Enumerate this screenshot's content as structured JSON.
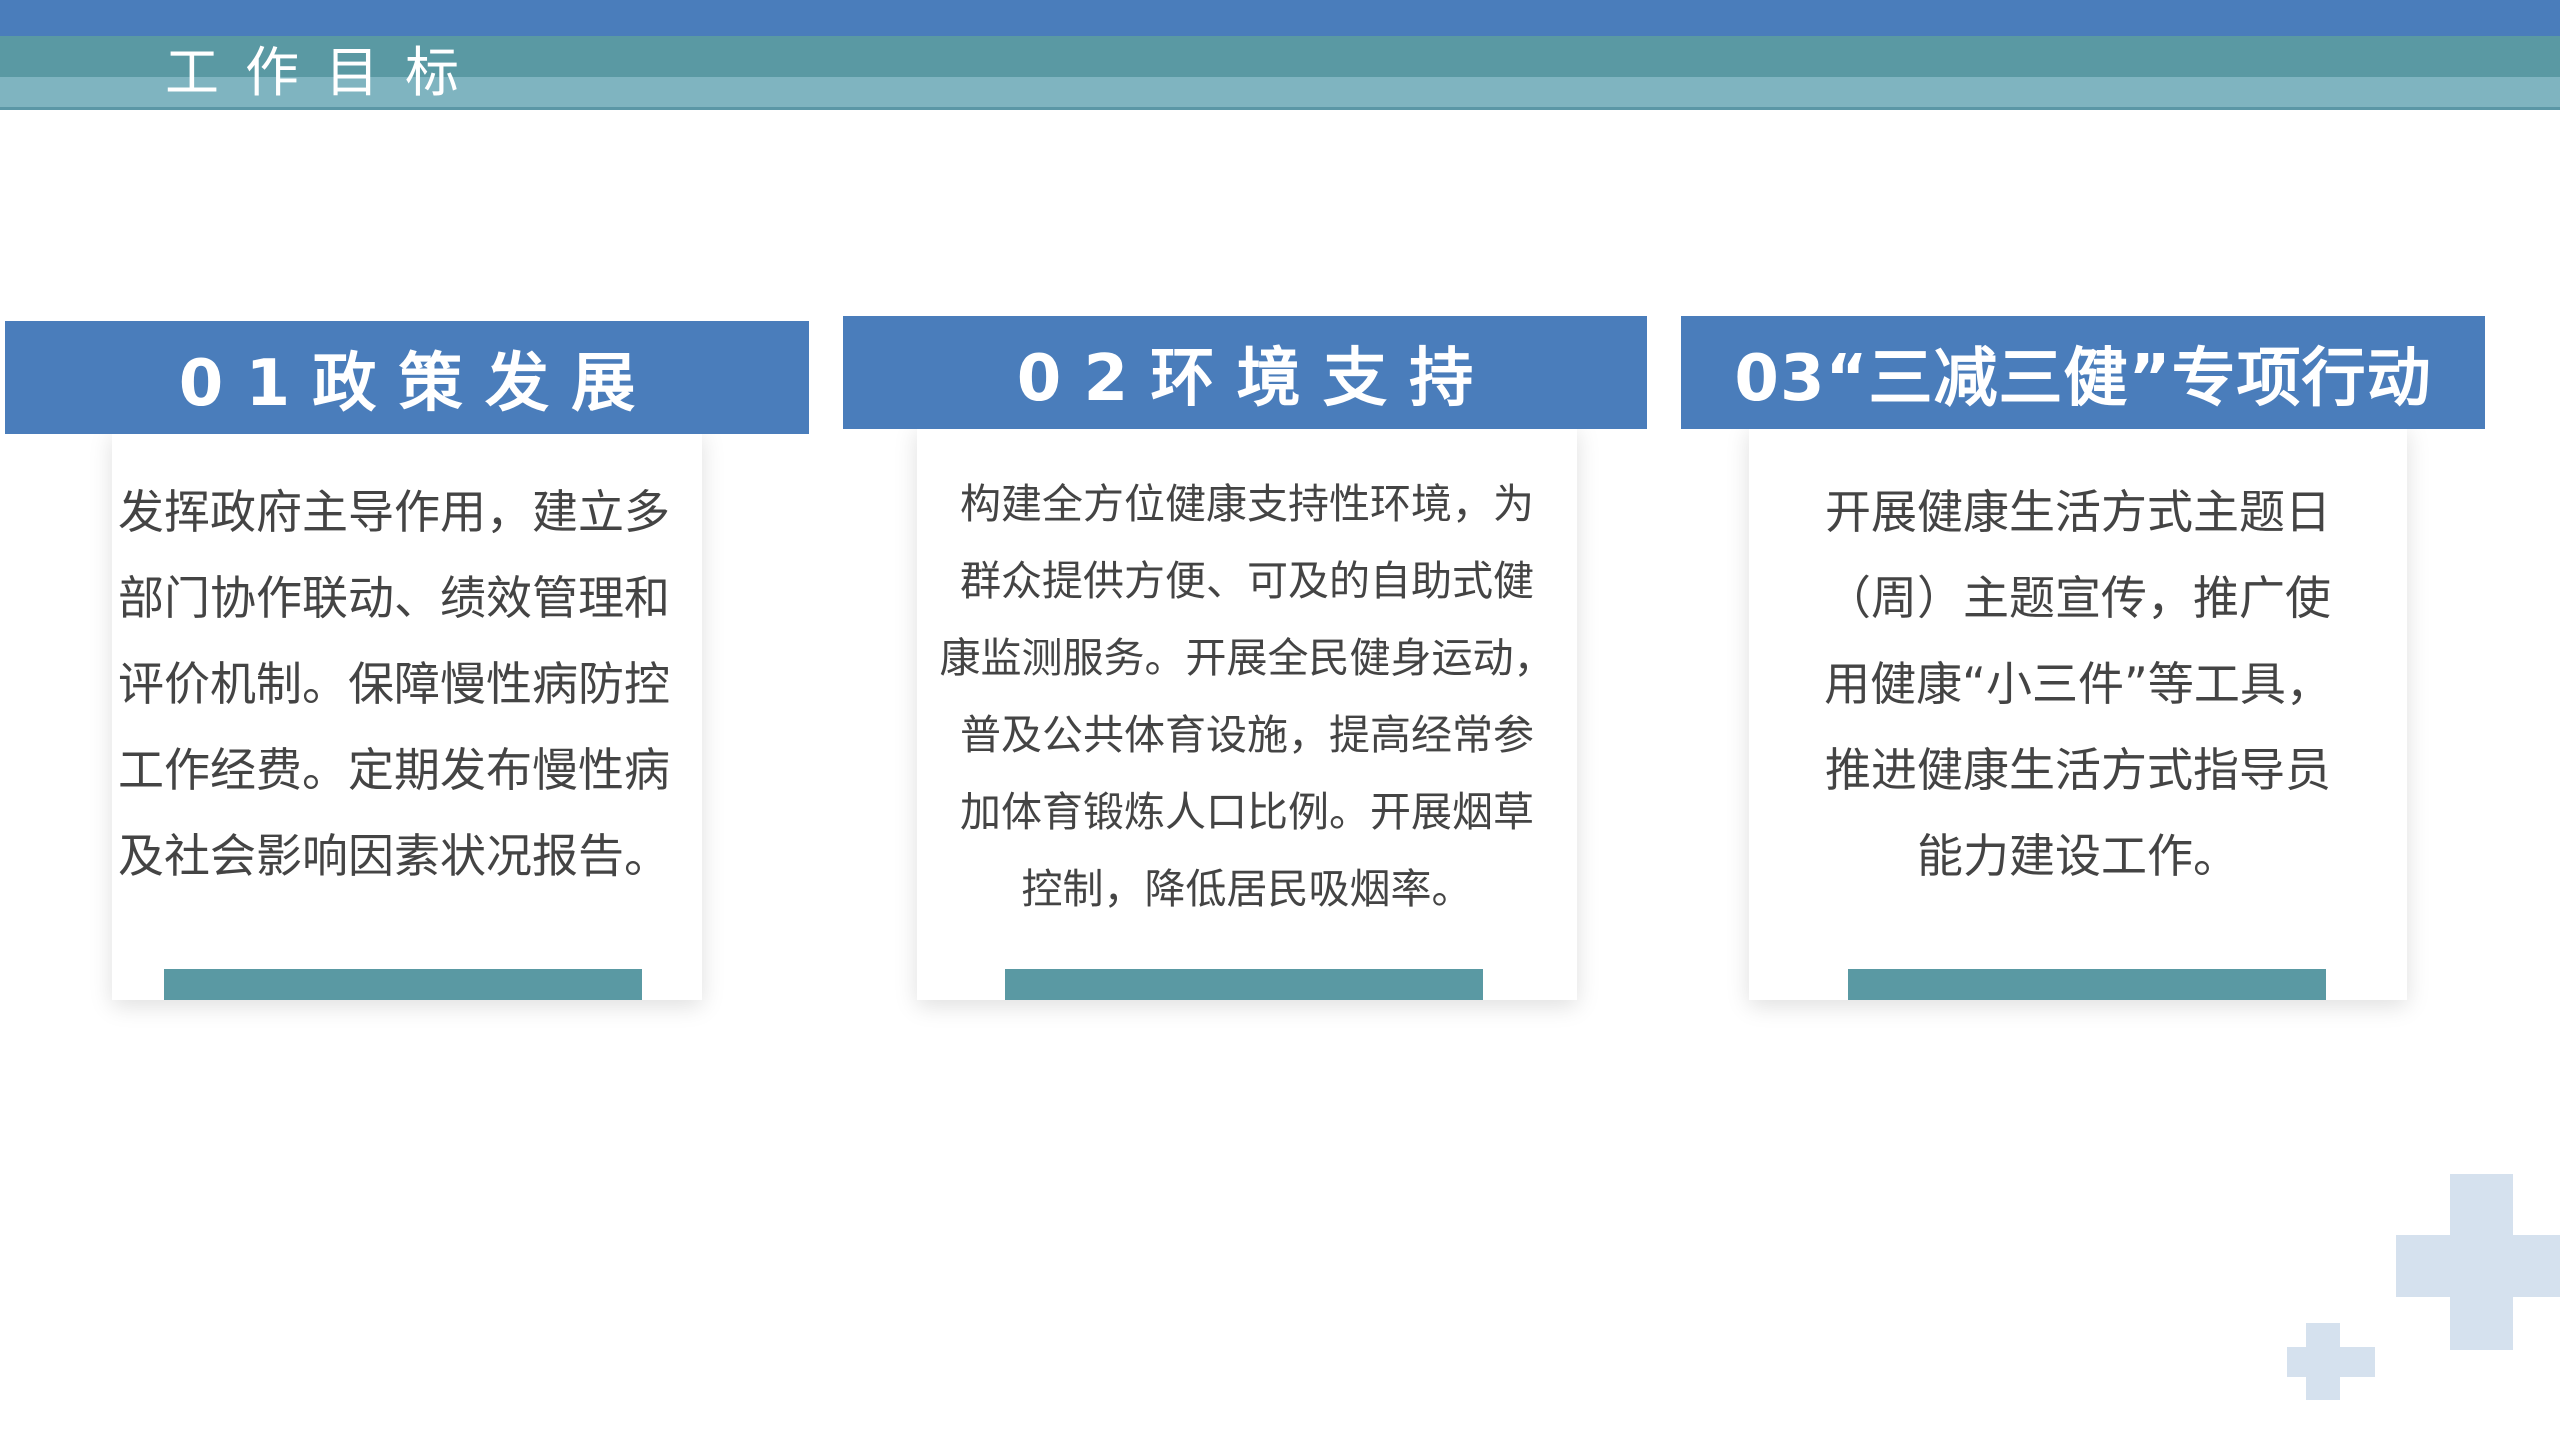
{
  "header": {
    "title": "工作目标"
  },
  "cards": [
    {
      "title": "0 1 政 策 发 展",
      "lines": [
        "发挥政府主导作用，建立多",
        "部门协作联动、绩效管理和",
        "评价机制。保障慢性病防控",
        "工作经费。定期发布慢性病",
        "及社会影响因素状况报告。"
      ]
    },
    {
      "title": "0 2 环 境 支 持",
      "lines": [
        "构建全方位健康支持性环境，为",
        "群众提供方便、可及的自助式健",
        "康监测服务。开展全民健身运动，",
        "普及公共体育设施，提高经常参",
        "加体育锻炼人口比例。开展烟草",
        "控制，降低居民吸烟率。"
      ]
    },
    {
      "title": "03“三减三健”专项行动",
      "lines": [
        "开展健康生活方式主题日",
        "（周）主题宣传，推广使",
        "用健康“小三件”等工具，",
        "推进健康生活方式指导员",
        "能力建设工作。"
      ]
    }
  ],
  "colors": {
    "primary_blue": "#4a7dbb",
    "teal": "#5a99a3",
    "light_teal": "#7fb4c0",
    "cross": "#d5e1ee"
  },
  "decorations": [
    "plus-icon-large",
    "plus-icon-small"
  ]
}
